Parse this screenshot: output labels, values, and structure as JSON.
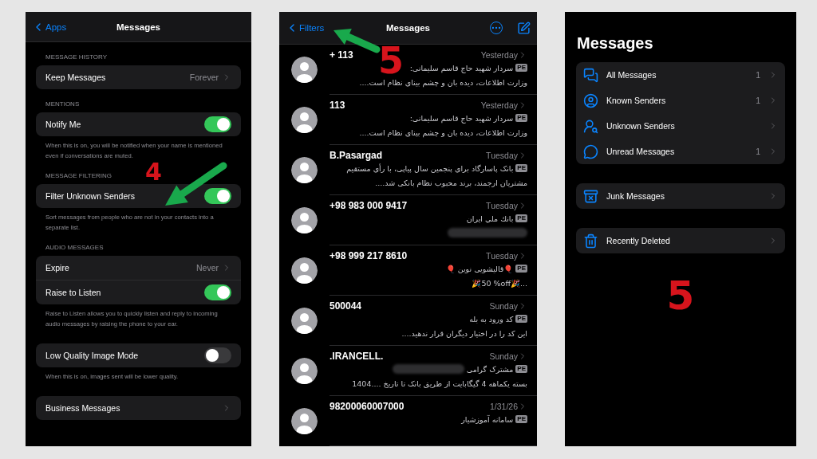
{
  "settings_screen": {
    "back": "Apps",
    "title": "Messages",
    "annotation": "4",
    "sections": [
      {
        "header": "MESSAGE HISTORY",
        "rows": [
          {
            "kind": "value",
            "label": "Keep Messages",
            "value": "Forever"
          }
        ]
      },
      {
        "header": "MENTIONS",
        "rows": [
          {
            "kind": "toggle",
            "label": "Notify Me",
            "on": true
          }
        ],
        "footer": "When this is on, you will be notified when your name is mentioned even if conversations are muted."
      },
      {
        "header": "MESSAGE FILTERING",
        "rows": [
          {
            "kind": "toggle",
            "label": "Filter Unknown Senders",
            "on": true
          }
        ],
        "footer": "Sort messages from people who are not in your contacts into a separate list."
      },
      {
        "header": "AUDIO MESSAGES",
        "rows": [
          {
            "kind": "value",
            "label": "Expire",
            "value": "Never"
          },
          {
            "kind": "toggle",
            "label": "Raise to Listen",
            "on": true
          }
        ],
        "footer": "Raise to Listen allows you to quickly listen and reply to incoming audio messages by raising the phone to your ear."
      },
      {
        "rows": [
          {
            "kind": "toggle",
            "label": "Low Quality Image Mode",
            "on": false
          }
        ],
        "footer": "When this is on, images sent will be lower quality."
      },
      {
        "rows": [
          {
            "kind": "link",
            "label": "Business Messages"
          }
        ]
      }
    ]
  },
  "messages_screen": {
    "back": "Filters",
    "title": "Messages",
    "annotation": "5",
    "conversations": [
      {
        "name": "+ 113",
        "time": "Yesterday",
        "sim": "PE",
        "lines": [
          "سردار شهید حاج قاسم سلیمانی:",
          "وزارت اطلاعات، دیده بان و چشم بینای نظام است...."
        ]
      },
      {
        "name": "113",
        "time": "Yesterday",
        "sim": "PE",
        "lines": [
          "سردار شهید حاج قاسم سلیمانی:",
          "وزارت اطلاعات، دیده بان و چشم بینای نظام است...."
        ]
      },
      {
        "name": "B.Pasargad",
        "time": "Tuesday",
        "sim": "PE",
        "lines": [
          "بانک پاسارگاد برای پنجمین سال پیاپی، با رأی مستقیم",
          "مشتریان ارجمند، برند محبوب نظام بانکی شد...."
        ]
      },
      {
        "name": "+98 983 000 9417",
        "time": "Tuesday",
        "sim": "PE",
        "lines": [
          "بانك ملي ايران"
        ],
        "redacted": true
      },
      {
        "name": "+98 999 217 8610",
        "time": "Tuesday",
        "sim": "PE",
        "lines": [
          "🎈قالیشویی نوین 🎈",
          "🎉50 %off🎉..."
        ]
      },
      {
        "name": "500044",
        "time": "Sunday",
        "sim": "PE",
        "lines": [
          "کد ورود به بله",
          "این کد را در اختیار دیگران قرار ندهید...."
        ]
      },
      {
        "name": ".IRANCELL.",
        "time": "Sunday",
        "sim": "PE",
        "lines": [
          "مشترک گرامی",
          "بسته یکماهه 4 گیگابایت از طریق بانک  تا تاریخ ....1404"
        ],
        "redacted": true
      },
      {
        "name": "98200060007000",
        "time": "1/31/26",
        "sim": "PE",
        "lines": [
          "سامانه آموزشیار"
        ]
      }
    ]
  },
  "filters_screen": {
    "title": "Messages",
    "annotation": "5",
    "groups": [
      [
        {
          "kind": "all",
          "label": "All Messages",
          "count": "1"
        },
        {
          "kind": "known",
          "label": "Known Senders",
          "count": "1"
        },
        {
          "kind": "unknown",
          "label": "Unknown Senders"
        },
        {
          "kind": "unread",
          "label": "Unread Messages",
          "count": "1"
        }
      ],
      [
        {
          "kind": "junk",
          "label": "Junk Messages"
        }
      ],
      [
        {
          "kind": "deleted",
          "label": "Recently Deleted"
        }
      ]
    ]
  }
}
